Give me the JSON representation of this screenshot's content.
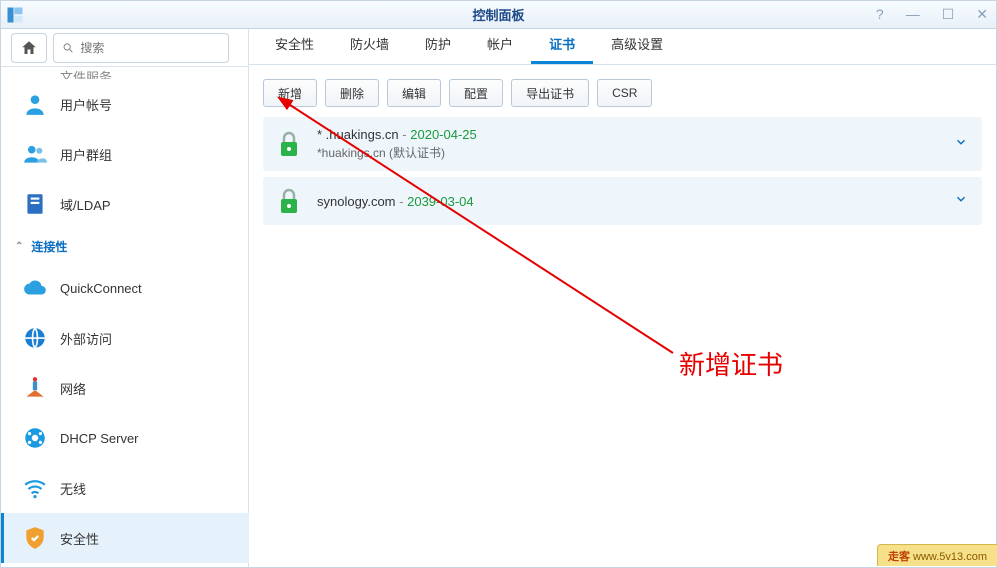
{
  "window": {
    "title": "控制面板"
  },
  "search": {
    "placeholder": "搜索"
  },
  "sidebar": {
    "partial_top": "文件服务",
    "items": [
      {
        "label": "用户帐号"
      },
      {
        "label": "用户群组"
      },
      {
        "label": "域/LDAP"
      }
    ],
    "section_connectivity": "连接性",
    "conn_items": [
      {
        "label": "QuickConnect"
      },
      {
        "label": "外部访问"
      },
      {
        "label": "网络"
      },
      {
        "label": "DHCP Server"
      },
      {
        "label": "无线"
      },
      {
        "label": "安全性"
      }
    ]
  },
  "tabs": [
    {
      "label": "安全性"
    },
    {
      "label": "防火墙"
    },
    {
      "label": "防护"
    },
    {
      "label": "帐户"
    },
    {
      "label": "证书",
      "active": true
    },
    {
      "label": "高级设置"
    }
  ],
  "actions": {
    "add": "新增",
    "delete": "删除",
    "edit": "编辑",
    "config": "配置",
    "export": "导出证书",
    "csr": "CSR"
  },
  "certs": [
    {
      "domain": "* .huakings.cn",
      "expiry": "2020-04-25",
      "sub": "*huakings.cn (默认证书)"
    },
    {
      "domain": "synology.com",
      "expiry": "2039-03-04",
      "sub": ""
    }
  ],
  "annotation": "新增证书",
  "watermark": {
    "brand": "走客",
    "url": "www.5v13.com"
  }
}
